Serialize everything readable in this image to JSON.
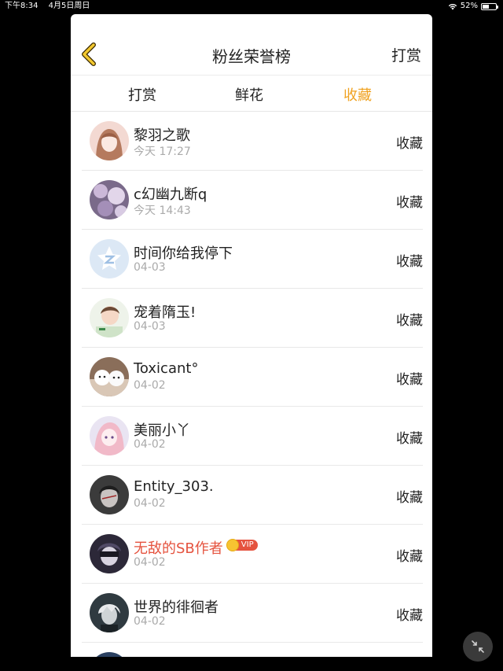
{
  "status_bar": {
    "time": "下午8:34",
    "date": "4月5日周日",
    "battery": "52%",
    "battery_level": 0.52
  },
  "header": {
    "title": "粉丝荣誉榜",
    "right_action": "打赏"
  },
  "tabs": [
    {
      "label": "打赏",
      "active": false
    },
    {
      "label": "鲜花",
      "active": false
    },
    {
      "label": "收藏",
      "active": true
    }
  ],
  "colors": {
    "accent": "#f0a220",
    "vip_name": "#e5533f"
  },
  "rows": [
    {
      "name": "黎羽之歌",
      "date": "今天 17:27",
      "action": "收藏"
    },
    {
      "name": "c幻幽九断q",
      "date": "今天 14:43",
      "action": "收藏"
    },
    {
      "name": "时间你给我停下",
      "date": "04-03",
      "action": "收藏"
    },
    {
      "name": "宠着隋玉!",
      "date": "04-03",
      "action": "收藏"
    },
    {
      "name": "Toxicant°",
      "date": "04-02",
      "action": "收藏"
    },
    {
      "name": "美丽小丫",
      "date": "04-02",
      "action": "收藏"
    },
    {
      "name": "Entity_303.",
      "date": "04-02",
      "action": "收藏"
    },
    {
      "name": "无敌的SB作者",
      "date": "04-02",
      "action": "收藏",
      "vip": "VIP"
    },
    {
      "name": "世界的徘徊者",
      "date": "04-02",
      "action": "收藏"
    }
  ]
}
